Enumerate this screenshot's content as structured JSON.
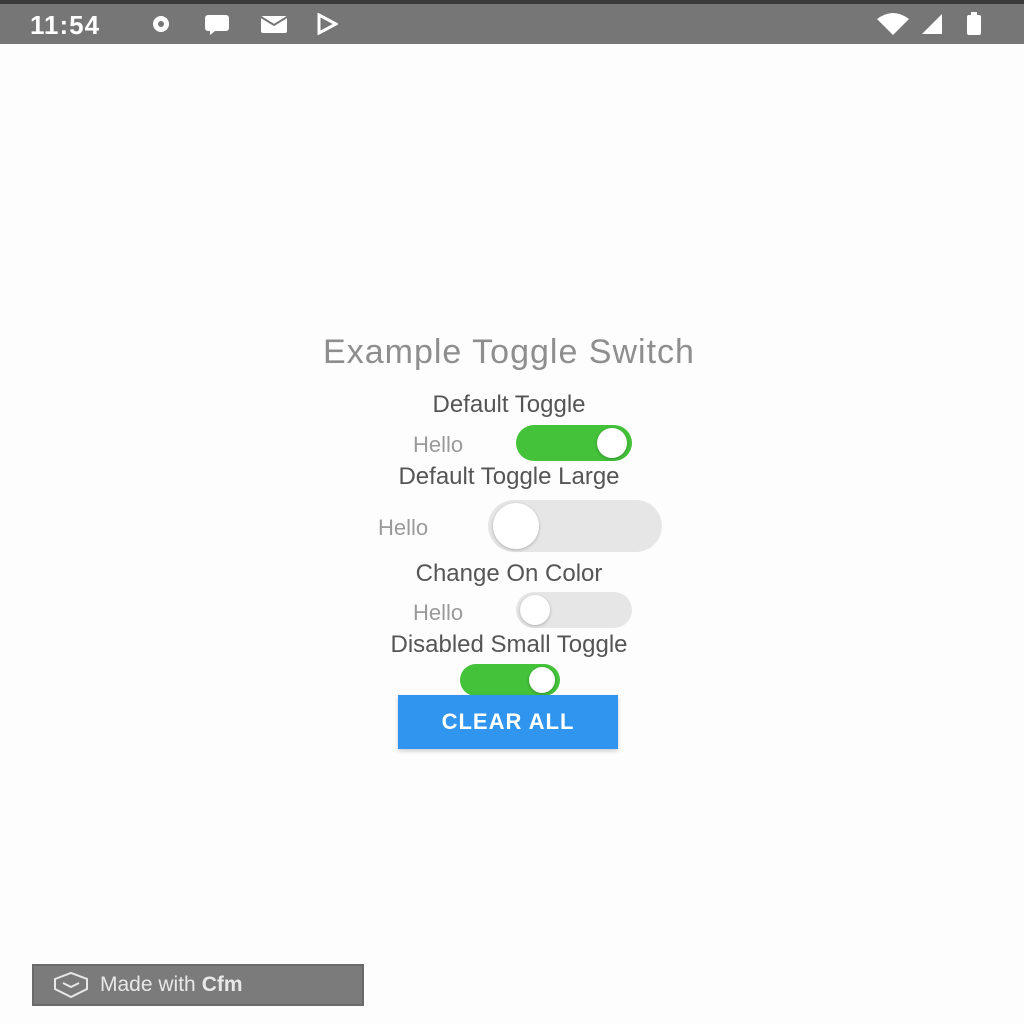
{
  "status_bar": {
    "time": "11:54",
    "left_icons": [
      "settings-icon",
      "chat-icon",
      "mail-icon",
      "play-store-icon"
    ],
    "right_icons": [
      "wifi-icon",
      "signal-icon",
      "battery-icon"
    ]
  },
  "page": {
    "title": "Example Toggle Switch"
  },
  "sections": [
    {
      "label": "Default Toggle",
      "row_label": "Hello",
      "on": true
    },
    {
      "label": "Default Toggle Large",
      "row_label": "Hello",
      "on": false
    },
    {
      "label": "Change On Color",
      "row_label": "Hello",
      "on": false
    },
    {
      "label": "Disabled Small Toggle",
      "row_label": "",
      "on": true
    }
  ],
  "clear_button": {
    "label": "CLEAR ALL"
  },
  "badge": {
    "prefix": "Made with",
    "brand": "Cfm"
  },
  "colors": {
    "toggle_on": "#44c23a",
    "toggle_off": "#e6e6e6",
    "button": "#2f95ee",
    "status_bar": "#767676"
  }
}
